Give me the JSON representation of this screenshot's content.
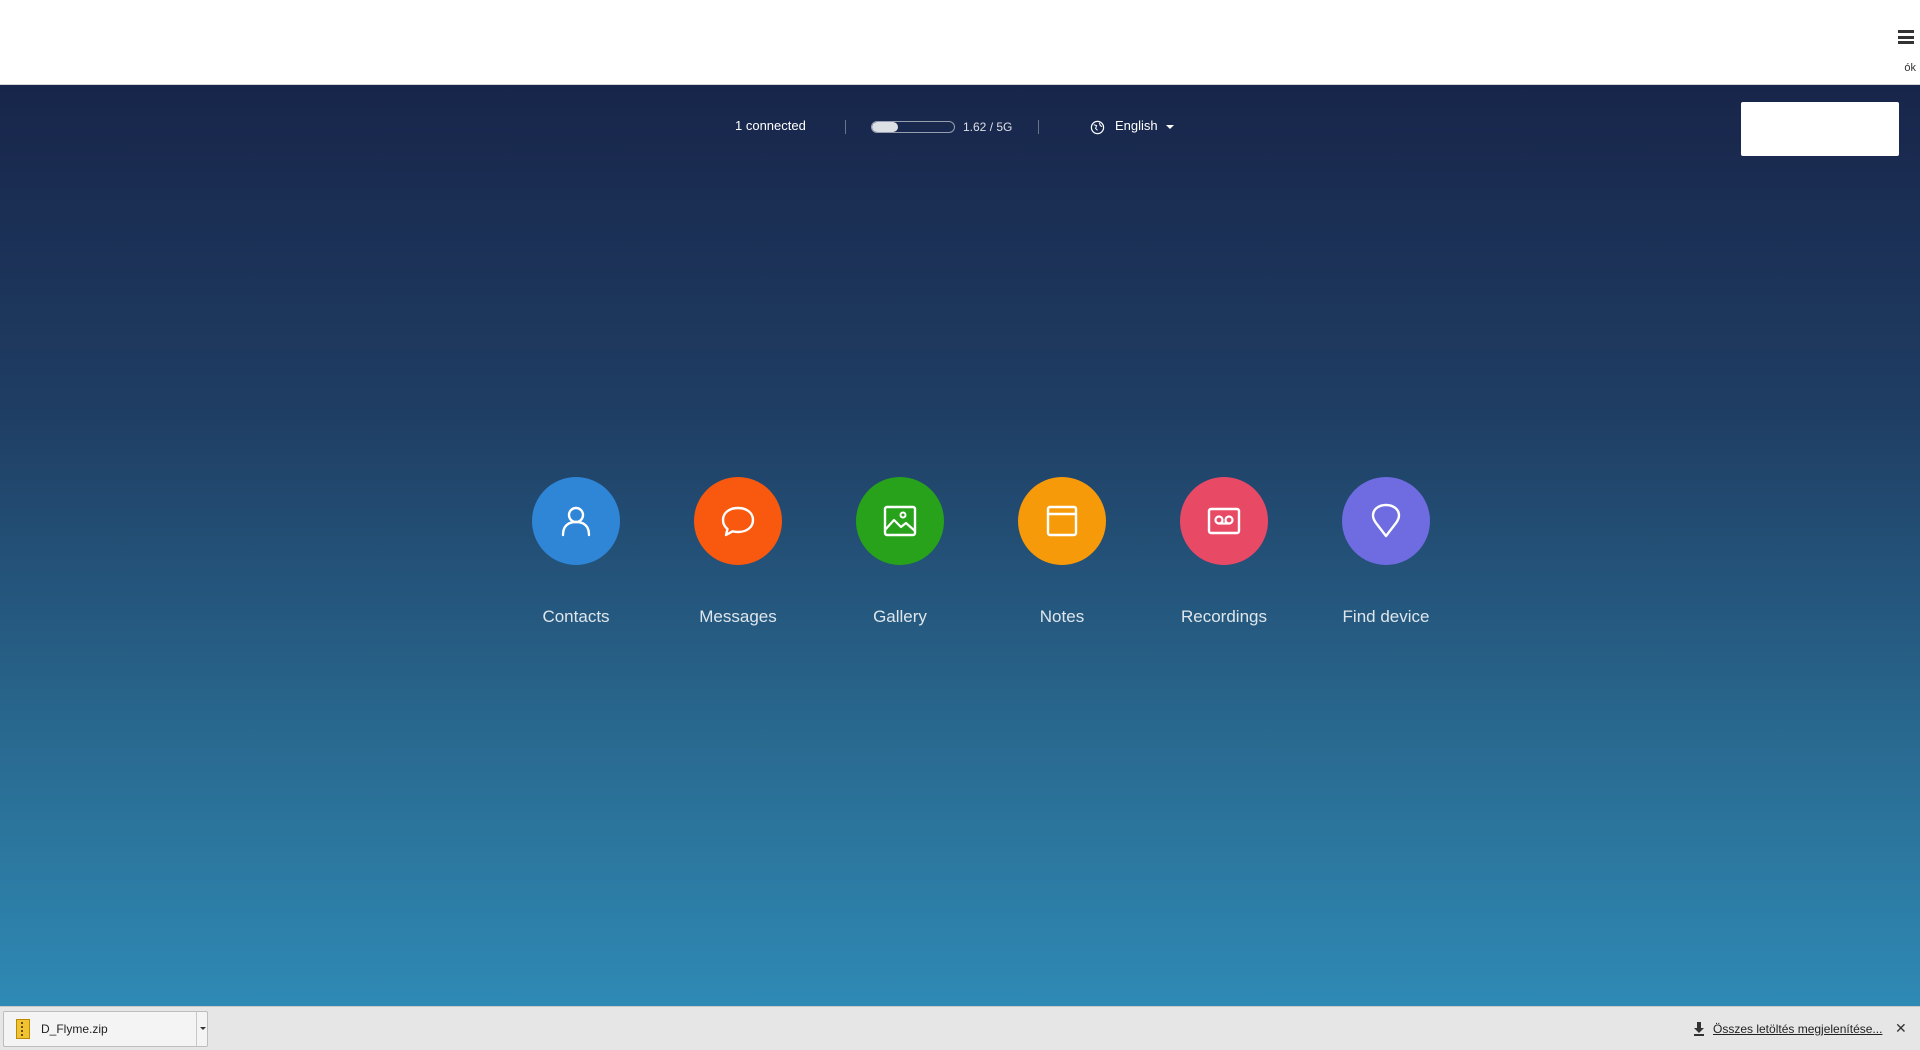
{
  "status": {
    "connected": "1 connected",
    "storage_text": "1.62 / 5G",
    "storage_fraction": 0.32,
    "language": "English"
  },
  "browser": {
    "menu_caption": "ók"
  },
  "apps": [
    {
      "label": "Contacts",
      "color": "#2f86d6",
      "icon": "person-icon"
    },
    {
      "label": "Messages",
      "color": "#f8590f",
      "icon": "chat-bubble-icon"
    },
    {
      "label": "Gallery",
      "color": "#27a21a",
      "icon": "image-icon"
    },
    {
      "label": "Notes",
      "color": "#f79a0a",
      "icon": "note-icon"
    },
    {
      "label": "Recordings",
      "color": "#e84a66",
      "icon": "cassette-icon"
    },
    {
      "label": "Find device",
      "color": "#6e6ce0",
      "icon": "location-pin-icon"
    }
  ],
  "download_bar": {
    "file_name": "D_Flyme.zip",
    "show_all": "Összes letöltés megjelenítése..."
  }
}
